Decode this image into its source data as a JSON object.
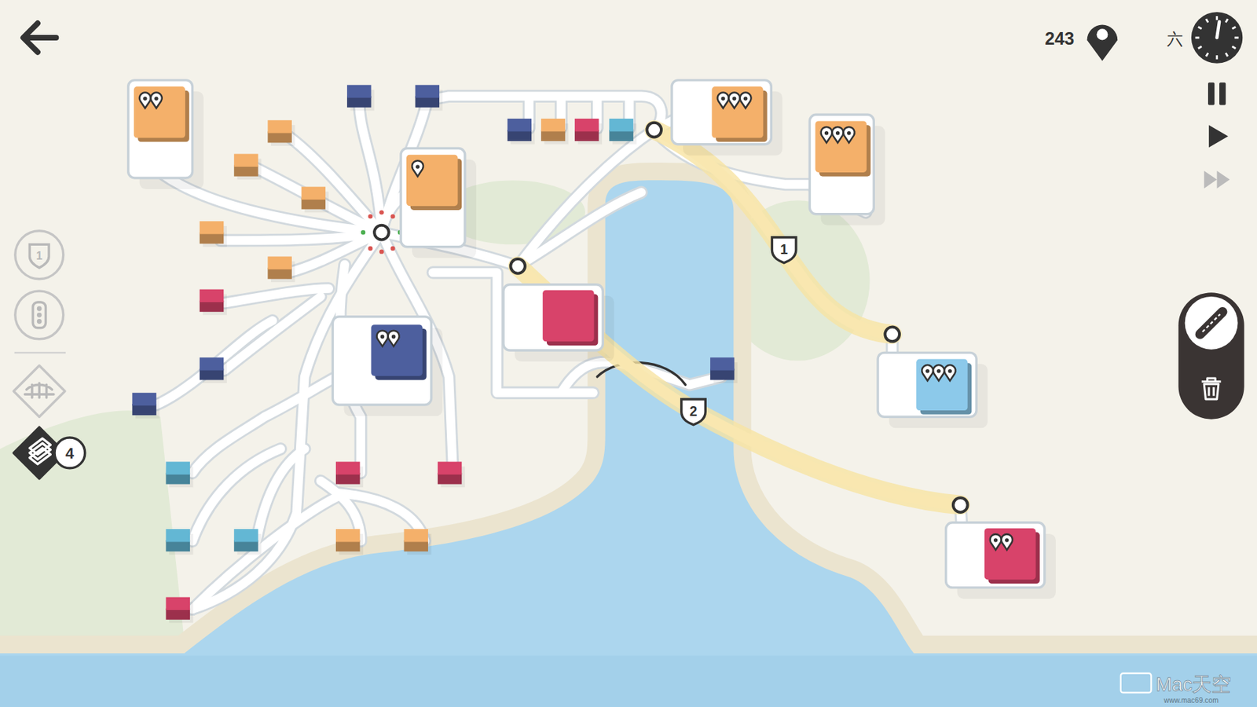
{
  "score": {
    "value": "243"
  },
  "day": {
    "label": "六"
  },
  "tools": [
    {
      "kind": "motorway",
      "label": "1",
      "selected": false
    },
    {
      "kind": "traffic-light",
      "selected": false
    },
    {
      "kind": "bridge",
      "selected": false
    },
    {
      "kind": "highway",
      "count": "4",
      "selected": true
    }
  ],
  "playback": [
    {
      "kind": "pause",
      "dimmed": false
    },
    {
      "kind": "play",
      "dimmed": false
    },
    {
      "kind": "fast-forward",
      "dimmed": true
    }
  ],
  "edit_mode": [
    {
      "kind": "road",
      "selected": true
    },
    {
      "kind": "delete",
      "selected": false
    }
  ],
  "highways": [
    {
      "label": "1"
    },
    {
      "label": "2"
    }
  ],
  "destinations": [
    {
      "color": "#f4b06a",
      "pins": 2
    },
    {
      "color": "#f4b06a",
      "pins": 1
    },
    {
      "color": "#4d5f9e",
      "pins": 2
    },
    {
      "color": "#d8436a",
      "pins": 0
    },
    {
      "color": "#f4b06a",
      "pins": 3
    },
    {
      "color": "#f4b06a",
      "pins": 3
    },
    {
      "color": "#8cc9ea",
      "pins": 3
    },
    {
      "color": "#d8436a",
      "pins": 2
    }
  ],
  "houses": [
    {
      "color": "#4d5f9e"
    },
    {
      "color": "#4d5f9e"
    },
    {
      "color": "#4d5f9e"
    },
    {
      "color": "#f4b06a"
    },
    {
      "color": "#d8436a"
    },
    {
      "color": "#63b7d4"
    },
    {
      "color": "#f4b06a"
    },
    {
      "color": "#f4b06a"
    },
    {
      "color": "#f4b06a"
    },
    {
      "color": "#f4b06a"
    },
    {
      "color": "#f4b06a"
    },
    {
      "color": "#d8436a"
    },
    {
      "color": "#4d5f9e"
    },
    {
      "color": "#4d5f9e"
    },
    {
      "color": "#4d5f9e"
    },
    {
      "color": "#63b7d4"
    },
    {
      "color": "#63b7d4"
    },
    {
      "color": "#63b7d4"
    },
    {
      "color": "#d8436a"
    },
    {
      "color": "#d8436a"
    },
    {
      "color": "#d8436a"
    },
    {
      "color": "#f4b06a"
    },
    {
      "color": "#f4b06a"
    }
  ],
  "watermark": {
    "text": "Mac天空",
    "url": "www.mac69.com"
  }
}
